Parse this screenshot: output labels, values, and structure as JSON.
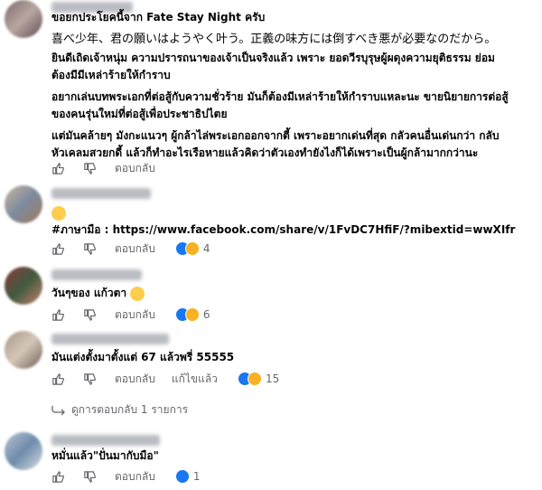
{
  "actions": {
    "reply_label": "ตอบกลับ",
    "edit_label": "แก้ไขแล้ว"
  },
  "comments": [
    {
      "lines": [
        "ขอยกประโยคนี้จาก Fate Stay Night ครับ",
        "喜べ少年、君の願いはようやく叶う。正義の味方には倒すべき悪が必要なのだから。",
        "ยินดีเถิดเจ้าหนุ่ม ความปรารถนาของเจ้าเป็นจริงแล้ว เพราะ ยอดวีรบุรุษผู้ผดุงความยุติธรรม ย่อม",
        "ต้องมีมีเหล่าร้ายให้กำราบ",
        "อยากเล่นบทพระเอกที่ต่อสู้กับความชั่วร้าย มันก็ต้องมีเหล่าร้ายให้กำราบแหละนะ ขายนิยายการต่อสู้",
        "ของคนรุ่นใหม่ที่ต่อสู้เพื่อประชาธิปไตย",
        "แต่มันคล้ายๆ มังกะแนวๆ ผู้กล้าไล่พระเอกออกจากตี้ เพราะอยากเด่นที่สุด กลัวคนอื่นเด่นกว่า กลับ",
        "หัวเคลมสวยกดี้ แล้วก็ทำอะไรเรือหายแล้วคิดว่าตัวเองทำยังไงก็ได้เพราะเป็นผู้กล้ามากกว่านะ"
      ]
    },
    {
      "link_label": "#ภาษามือ : https://www.facebook.com/share/v/1FvDC7HfiF/?mibextid=wwXIfr",
      "reaction_count": "4"
    },
    {
      "text": "วันๆของ แก้วตา",
      "reaction_count": "6"
    },
    {
      "text": "มันแต่งตั้งมาตั้งแต่ 67 แล้วพรี่ 55555",
      "reaction_count": "15",
      "replies_label": "ดูการตอบกลับ 1 รายการ"
    },
    {
      "text": "หมั่นแล้ว\"ปั่นมากับมือ\"",
      "reaction_count": "1"
    }
  ]
}
